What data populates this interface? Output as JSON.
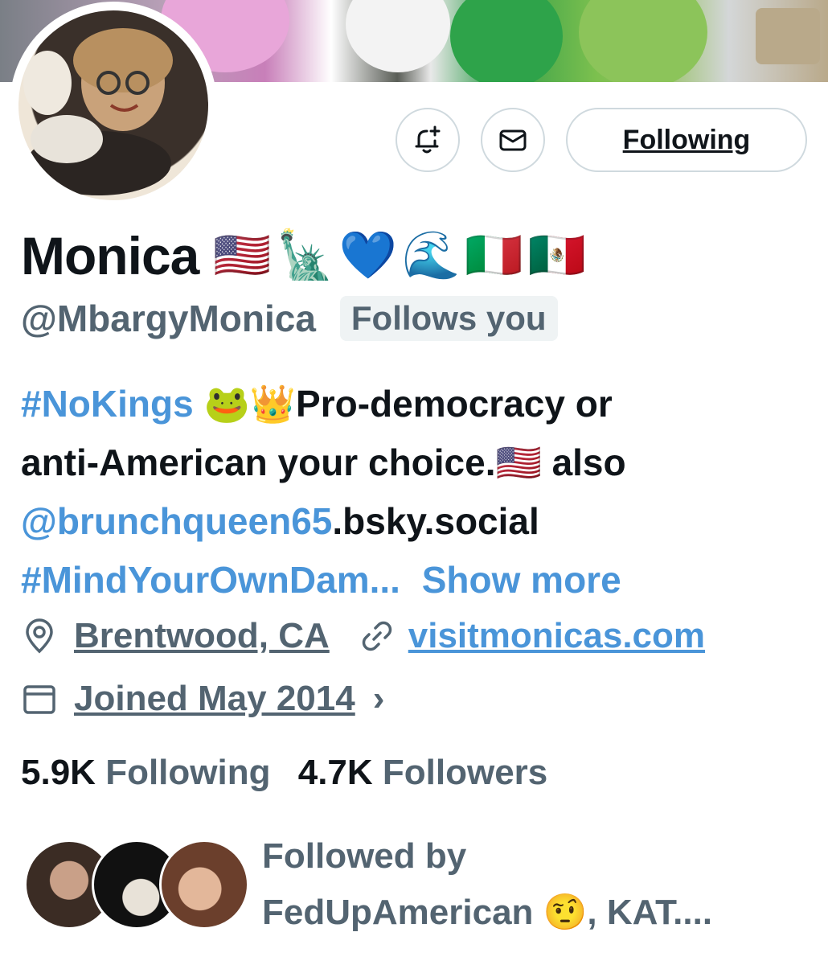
{
  "profile": {
    "name": "Monica",
    "name_emojis": "🇺🇸🗽💙🌊🇮🇹🇲🇽",
    "handle": "@MbargyMonica",
    "follows_you_badge": "Follows you"
  },
  "actions": {
    "follow_button_label": "Following"
  },
  "bio": {
    "line1_hashtag": "#NoKings",
    "line1_emojis": "🐸👑",
    "line1_text": "Pro-democracy or",
    "line2_text": "anti-American your choice.",
    "line2_emoji": "🇺🇸",
    "line2_text_end": "also",
    "line3_mention": "@brunchqueen65",
    "line3_text": ".bsky.social",
    "line4_hashtag": "#MindYourOwnDam...",
    "show_more": "Show more"
  },
  "meta": {
    "location": "Brentwood, CA",
    "website": "visitmonicas.com",
    "joined": "Joined May 2014",
    "joined_chevron": "›"
  },
  "stats": {
    "following_count": "5.9K",
    "following_label": "Following",
    "followers_count": "4.7K",
    "followers_label": "Followers"
  },
  "followed_by": {
    "line1": "Followed by",
    "line2": "FedUpAmerican 🤨, KAT...."
  },
  "icons": {
    "notify": "bell-plus-icon",
    "message": "envelope-icon",
    "location": "map-pin-icon",
    "website": "link-icon",
    "joined": "calendar-icon"
  },
  "colors": {
    "accent_blue": "#4a95d9",
    "secondary_text": "#536471",
    "primary_text": "#0f1419",
    "border": "#cfd9de"
  }
}
